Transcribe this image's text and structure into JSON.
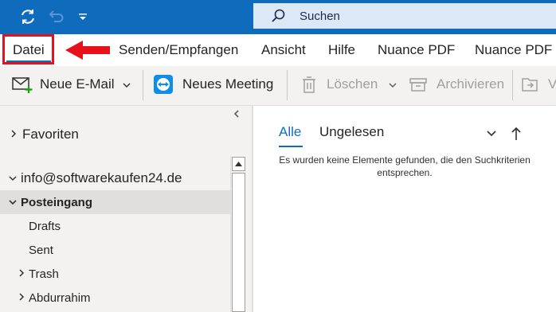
{
  "titlebar": {
    "search_placeholder": "Suchen",
    "brand_color": "#0f6cbd"
  },
  "menu": {
    "items": [
      "Datei",
      "Senden/Empfangen",
      "Ansicht",
      "Hilfe",
      "Nuance PDF",
      "Nuance PDF"
    ],
    "highlight_color": "#e8101a"
  },
  "ribbon": {
    "new_mail": "Neue E-Mail",
    "new_meeting": "Neues Meeting",
    "delete": "Löschen",
    "archive": "Archivieren",
    "move_partial": "V"
  },
  "folders": {
    "favorites": "Favoriten",
    "account": "info@softwarekaufen24.de",
    "inbox": "Posteingang",
    "drafts": "Drafts",
    "sent": "Sent",
    "trash": "Trash",
    "abdurrahim": "Abdurrahim"
  },
  "message_list": {
    "tab_all": "Alle",
    "tab_unread": "Ungelesen",
    "empty_line1": "Es wurden keine Elemente gefunden, die den Suchkriterien",
    "empty_line2": "entsprechen."
  }
}
